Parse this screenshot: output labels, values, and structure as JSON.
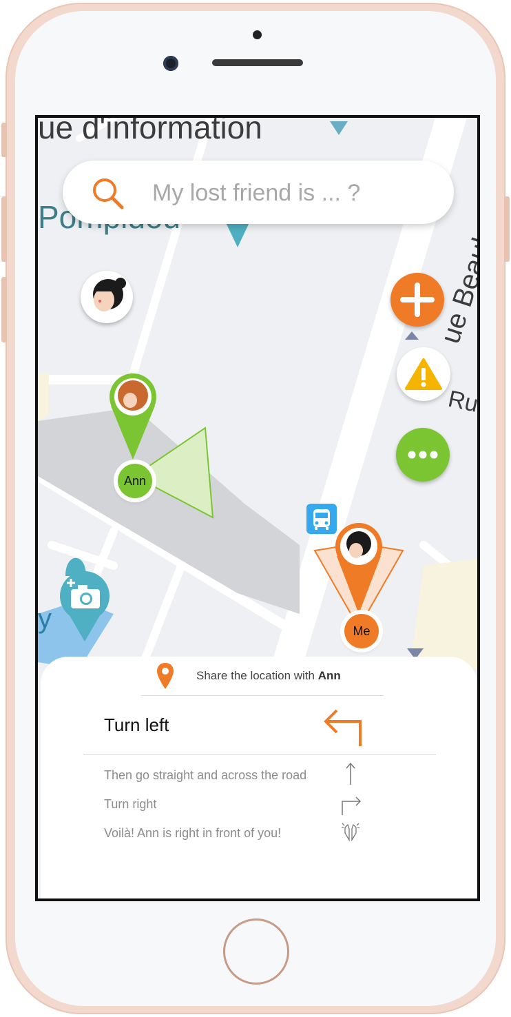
{
  "search": {
    "placeholder": "My lost friend is ... ?"
  },
  "map": {
    "labels": {
      "top_street": "ue d'information",
      "place": "Pompidou",
      "right_street": "ue Beaub",
      "right_street_2": "Ru",
      "left_edge": "y"
    },
    "ann_label": "Ann",
    "me_label": "Me"
  },
  "sheet": {
    "share_prefix": "Share the location with ",
    "share_name": "Ann",
    "current_step": "Turn left",
    "next_steps": [
      {
        "text": "Then go straight and across the road",
        "icon": "arrow-up-icon"
      },
      {
        "text": "Turn right",
        "icon": "turn-right-icon"
      },
      {
        "text": "Voilà! Ann is right in front of you!",
        "icon": "praise-hands-icon"
      }
    ]
  },
  "colors": {
    "accent": "#f07b26",
    "friend": "#7cc532",
    "info": "#4eb0c2",
    "warning": "#f5b400"
  }
}
